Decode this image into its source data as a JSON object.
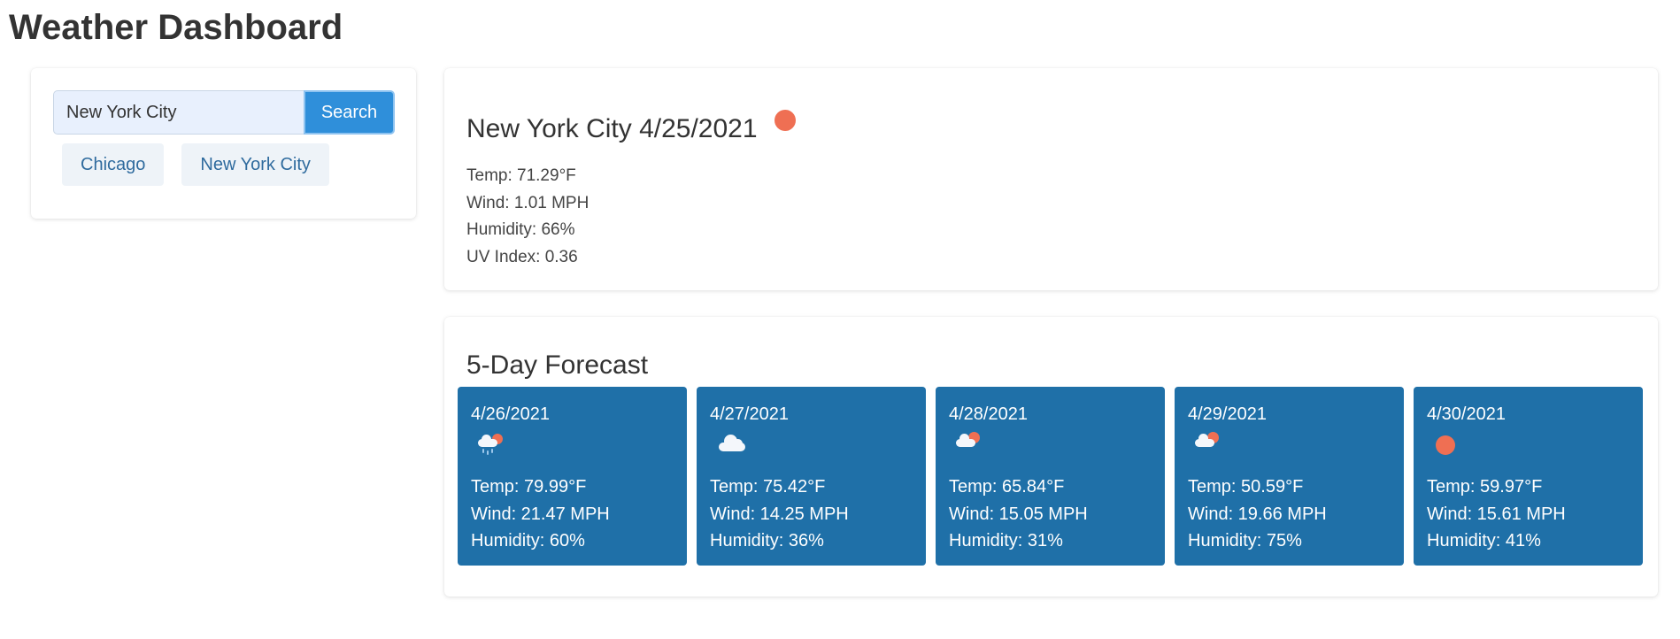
{
  "app": {
    "title": "Weather Dashboard"
  },
  "search": {
    "input_value": "New York City",
    "button_label": "Search",
    "history": [
      "Chicago",
      "New York City"
    ]
  },
  "current": {
    "heading": "New York City 4/25/2021",
    "icon": "sun-icon",
    "temp": "Temp: 71.29°F",
    "wind": "Wind: 1.01 MPH",
    "humidity": "Humidity: 66%",
    "uv": "UV Index: 0.36"
  },
  "forecast": {
    "title": "5-Day Forecast",
    "days": [
      {
        "date": "4/26/2021",
        "icon": "rain-cloud-sun-icon",
        "temp": "Temp: 79.99°F",
        "wind": "Wind: 21.47 MPH",
        "humidity": "Humidity: 60%"
      },
      {
        "date": "4/27/2021",
        "icon": "cloud-icon",
        "temp": "Temp: 75.42°F",
        "wind": "Wind: 14.25 MPH",
        "humidity": "Humidity: 36%"
      },
      {
        "date": "4/28/2021",
        "icon": "partly-cloudy-icon",
        "temp": "Temp: 65.84°F",
        "wind": "Wind: 15.05 MPH",
        "humidity": "Humidity: 31%"
      },
      {
        "date": "4/29/2021",
        "icon": "partly-cloudy-icon",
        "temp": "Temp: 50.59°F",
        "wind": "Wind: 19.66 MPH",
        "humidity": "Humidity: 75%"
      },
      {
        "date": "4/30/2021",
        "icon": "sun-icon",
        "temp": "Temp: 59.97°F",
        "wind": "Wind: 15.61 MPH",
        "humidity": "Humidity: 41%"
      }
    ]
  },
  "colors": {
    "accent": "#2f8fda",
    "forecast_card": "#1f70a8",
    "sun": "#ef6f53",
    "history_text": "#2f6b9e"
  }
}
